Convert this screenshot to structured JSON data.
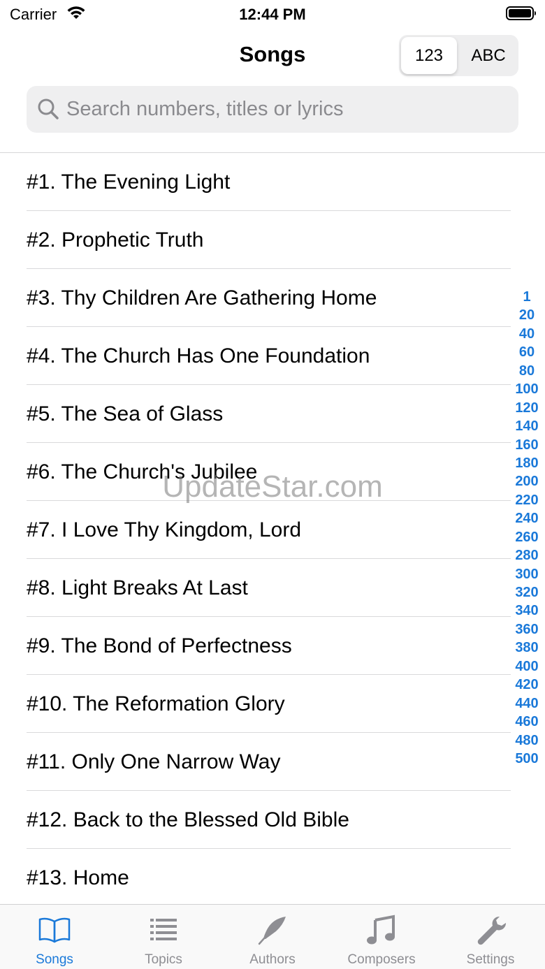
{
  "status_bar": {
    "carrier": "Carrier",
    "time": "12:44 PM"
  },
  "nav": {
    "title": "Songs"
  },
  "sort_toggle": {
    "options": [
      "123",
      "ABC"
    ],
    "selected": "123"
  },
  "search": {
    "placeholder": "Search numbers, titles or lyrics",
    "value": ""
  },
  "songs": [
    "#1. The Evening Light",
    "#2. Prophetic Truth",
    "#3. Thy Children Are Gathering Home",
    "#4. The Church Has One Foundation",
    "#5. The Sea of Glass",
    "#6. The Church's Jubilee",
    "#7. I Love Thy Kingdom, Lord",
    "#8. Light Breaks At Last",
    "#9. The Bond of Perfectness",
    "#10. The Reformation Glory",
    "#11. Only One Narrow Way",
    "#12. Back to the Blessed Old Bible",
    "#13. Home"
  ],
  "section_index": [
    "1",
    "20",
    "40",
    "60",
    "80",
    "100",
    "120",
    "140",
    "160",
    "180",
    "200",
    "220",
    "240",
    "260",
    "280",
    "300",
    "320",
    "340",
    "360",
    "380",
    "400",
    "420",
    "440",
    "460",
    "480",
    "500"
  ],
  "watermark": "UpdateStar.com",
  "tabs": [
    {
      "label": "Songs",
      "icon": "book-icon",
      "active": true
    },
    {
      "label": "Topics",
      "icon": "list-icon",
      "active": false
    },
    {
      "label": "Authors",
      "icon": "quill-icon",
      "active": false
    },
    {
      "label": "Composers",
      "icon": "music-note-icon",
      "active": false
    },
    {
      "label": "Settings",
      "icon": "wrench-icon",
      "active": false
    }
  ],
  "colors": {
    "accent": "#1a79d9",
    "inactive": "#8e8e93"
  }
}
